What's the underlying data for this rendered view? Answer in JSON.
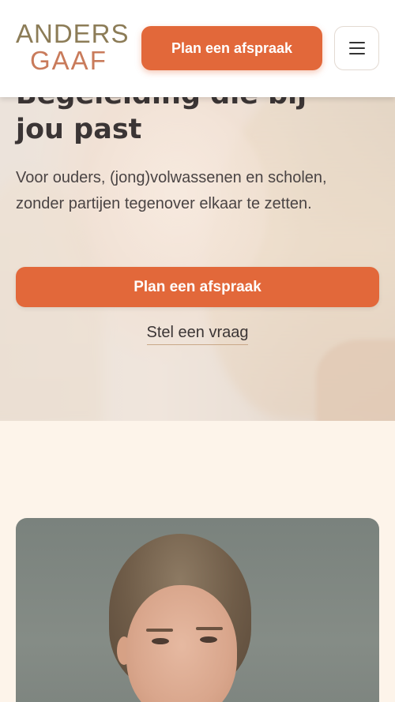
{
  "header": {
    "logo_top": "ANDERS",
    "logo_bottom": "GAAF",
    "cta_label": "Plan een afspraak",
    "menu_icon": "hamburger-menu-icon"
  },
  "hero": {
    "title": "Begeleiding die bij jou past",
    "subtitle": "Voor ouders, (jong)volwassenen en scholen, zonder partijen tegenover elkaar te zetten.",
    "primary_cta": "Plan een afspraak",
    "secondary_cta": "Stel een vraag"
  },
  "colors": {
    "accent": "#e2683a",
    "background": "#fdf4ea",
    "logo_top": "#8c7c57",
    "logo_bottom": "#c97b5b",
    "text": "#3b3535"
  }
}
